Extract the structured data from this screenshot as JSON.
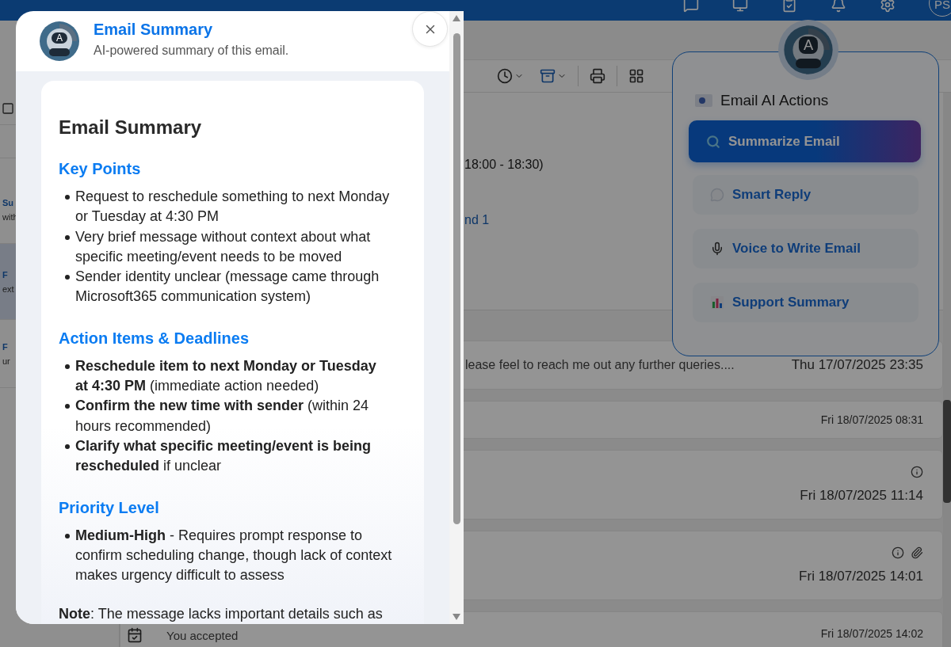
{
  "top_bar": {
    "avatar": "PS"
  },
  "message_list": {
    "items": [
      {
        "subject": "Su",
        "line": "with",
        "selected": false
      },
      {
        "subject": "F",
        "line": "ext",
        "selected": true
      },
      {
        "subject": "F",
        "line": "ur",
        "selected": false
      }
    ]
  },
  "reading_pane": {
    "time_text": "18:00 - 18:30)",
    "link_text": "nd 1",
    "thread": [
      {
        "kind": "message",
        "preview": "lease feel to reach me out any further queries....",
        "date": "Thu 17/07/2025 23:35",
        "expanded": true,
        "has_info": false,
        "has_attachment": false
      },
      {
        "kind": "message",
        "date": "Fri 18/07/2025 08:31",
        "expanded": false,
        "has_info": false,
        "has_attachment": false
      },
      {
        "kind": "message",
        "date": "Fri 18/07/2025 11:14",
        "expanded": true,
        "has_info": true,
        "has_attachment": false
      },
      {
        "kind": "message",
        "date": "Fri 18/07/2025 14:01",
        "expanded": true,
        "has_info": true,
        "has_attachment": true
      },
      {
        "kind": "event",
        "text": "You accepted",
        "date": "Fri 18/07/2025 14:02",
        "expanded": false,
        "has_info": false,
        "has_attachment": false
      }
    ]
  },
  "ai_panel": {
    "avatar_letter": "A",
    "title": "Email AI Actions",
    "actions": [
      {
        "label": "Summarize Email",
        "selected": true
      },
      {
        "label": "Smart Reply",
        "selected": false
      },
      {
        "label": "Voice to Write Email",
        "selected": false
      },
      {
        "label": "Support Summary",
        "selected": false
      }
    ]
  },
  "modal": {
    "avatar_letter": "A",
    "title": "Email Summary",
    "subtitle": "AI-powered summary of this email.",
    "summary": {
      "title": "Email Summary",
      "sections": [
        {
          "heading": "Key Points",
          "bullets": [
            "Request to reschedule something to next Monday or Tuesday at 4:30 PM",
            "Very brief message without context about what specific meeting/event needs to be moved",
            "Sender identity unclear (message came through Microsoft365 communication system)"
          ]
        },
        {
          "heading": "Action Items & Deadlines",
          "bullets": [
            "**Reschedule item to next Monday or Tuesday at 4:30 PM** (immediate action needed)",
            "**Confirm the new time with sender** (within 24 hours recommended)",
            "**Clarify what specific meeting/event is being rescheduled** if unclear"
          ]
        },
        {
          "heading": "Priority Level",
          "bullets": [
            "**Medium-High** - Requires prompt response to confirm scheduling change, though lack of context makes urgency difficult to assess"
          ]
        }
      ],
      "note": "**Note**: The message lacks important details such as"
    }
  }
}
